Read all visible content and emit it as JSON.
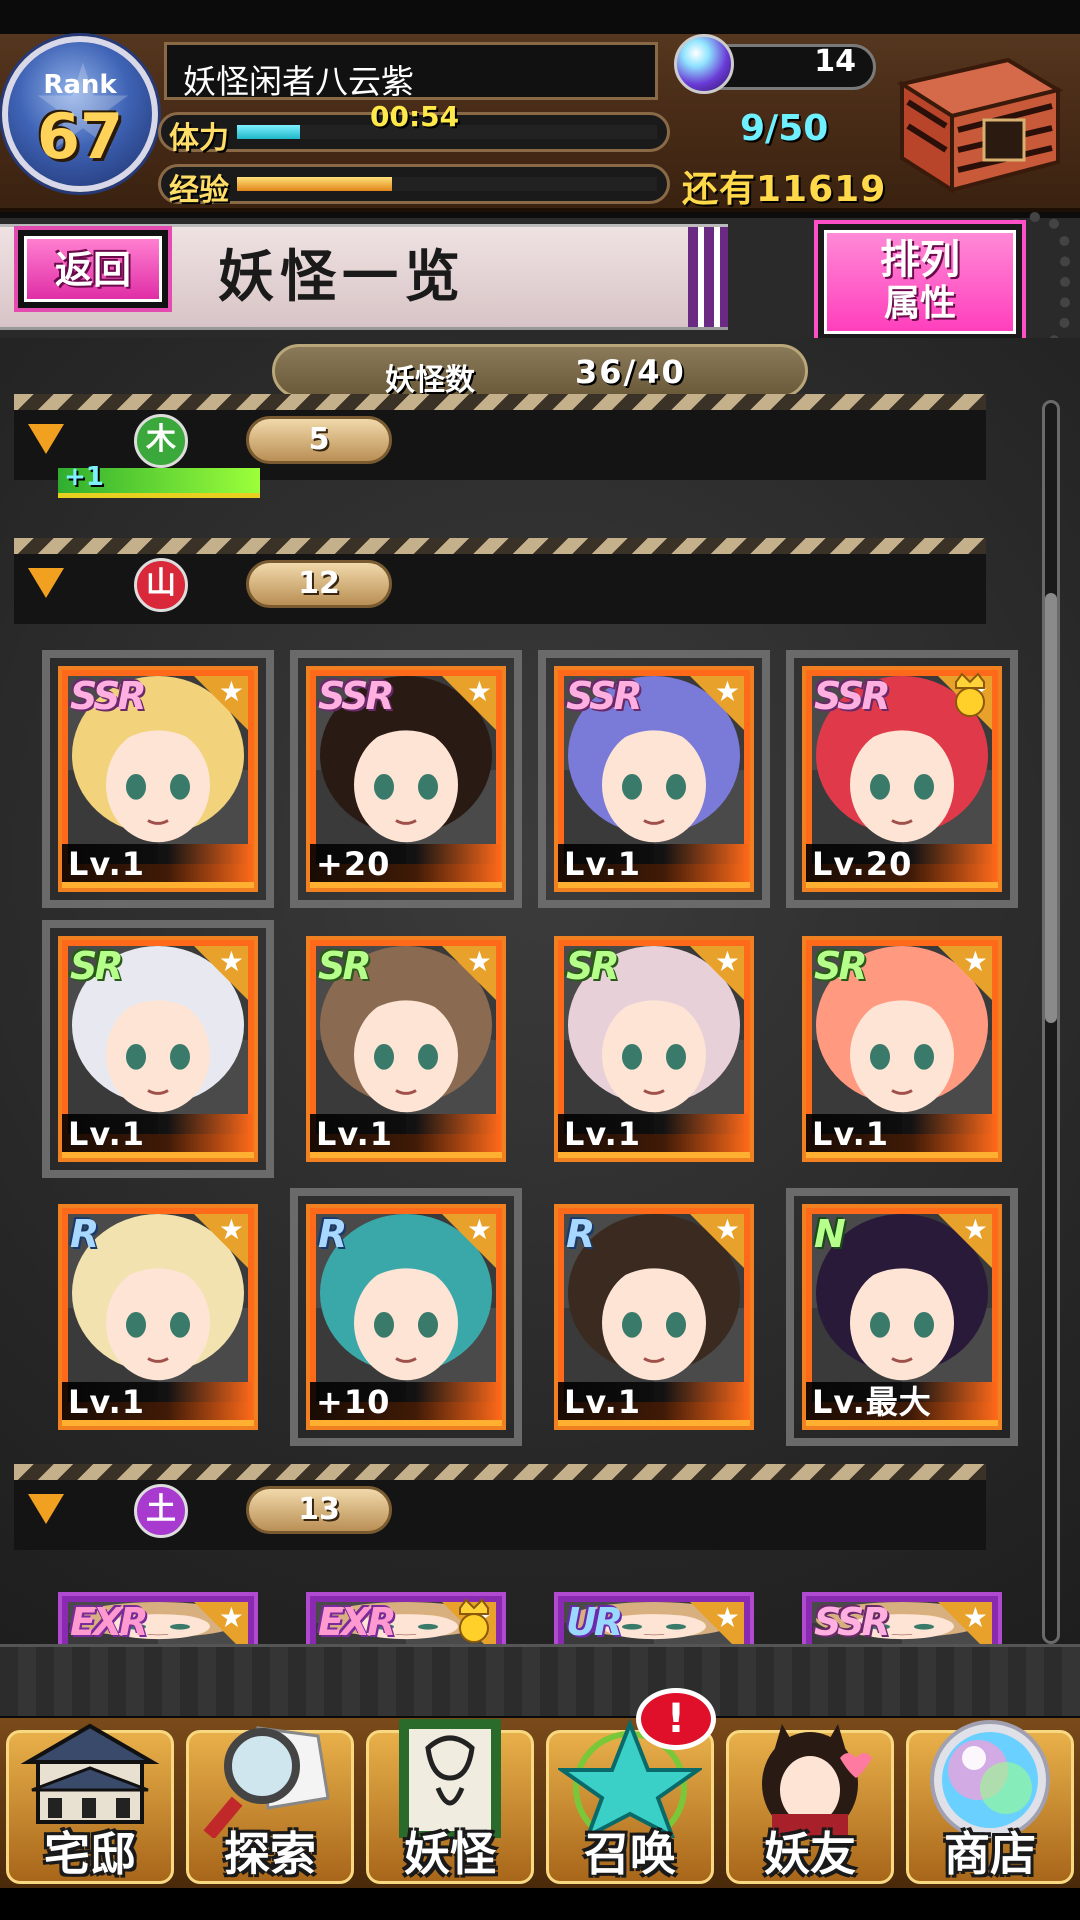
{
  "player": {
    "rank_label": "Rank",
    "rank": "67",
    "name": "妖怪闲者八云紫",
    "orbs": "14",
    "stamina_label": "体力",
    "stamina_timer": "00:54",
    "stamina_count": "9/50",
    "stamina_fraction": 0.15,
    "exp_label": "经验",
    "exp_remaining": "还有11619",
    "exp_fraction": 0.37
  },
  "header": {
    "back_label": "返回",
    "title": "妖怪一览",
    "sort_line1": "排列",
    "sort_line2": "属性"
  },
  "summary": {
    "count_label": "妖怪数",
    "count_value": "36/40"
  },
  "groups": [
    {
      "attr_glyph": "木",
      "attr_color": "#3aa83a",
      "count": "5",
      "bonus": "+1"
    },
    {
      "attr_glyph": "山",
      "attr_color": "#d8283a",
      "count": "12"
    },
    {
      "attr_glyph": "土",
      "attr_color": "#a83ad0",
      "count": "13"
    }
  ],
  "cards_group2": [
    {
      "rarity": "SSR",
      "level": "Lv.1",
      "hair": "#f2d27a",
      "framed": true,
      "crown": false
    },
    {
      "rarity": "SSR",
      "level": "+20",
      "hair": "#2a1a14",
      "framed": true,
      "crown": false
    },
    {
      "rarity": "SSR",
      "level": "Lv.1",
      "hair": "#7a7ad8",
      "framed": true,
      "crown": false
    },
    {
      "rarity": "SSR",
      "level": "Lv.20",
      "hair": "#e03a4a",
      "framed": true,
      "crown": true
    },
    {
      "rarity": "SR",
      "level": "Lv.1",
      "hair": "#e8e8f0",
      "framed": true,
      "crown": false
    },
    {
      "rarity": "SR",
      "level": "Lv.1",
      "hair": "#8a6a50",
      "framed": false,
      "crown": false
    },
    {
      "rarity": "SR",
      "level": "Lv.1",
      "hair": "#e8d0d8",
      "framed": false,
      "crown": false
    },
    {
      "rarity": "SR",
      "level": "Lv.1",
      "hair": "#ff9a80",
      "framed": false,
      "crown": false
    },
    {
      "rarity": "R",
      "level": "Lv.1",
      "hair": "#f2e2b0",
      "framed": false,
      "crown": false
    },
    {
      "rarity": "R",
      "level": "+10",
      "hair": "#3aa8a8",
      "framed": true,
      "crown": false
    },
    {
      "rarity": "R",
      "level": "Lv.1",
      "hair": "#3a2a20",
      "framed": false,
      "crown": false
    },
    {
      "rarity": "N",
      "level": "Lv.最大",
      "hair": "#2a1a3a",
      "framed": true,
      "crown": false
    }
  ],
  "cards_group3": [
    {
      "rarity": "EXR",
      "crown": false
    },
    {
      "rarity": "EXR",
      "crown": true
    },
    {
      "rarity": "UR",
      "crown": false
    },
    {
      "rarity": "SSR",
      "crown": false
    }
  ],
  "nav": [
    {
      "label": "宅邸",
      "icon": "mansion-icon"
    },
    {
      "label": "探索",
      "icon": "magnifier-map-icon"
    },
    {
      "label": "妖怪",
      "icon": "scroll-icon"
    },
    {
      "label": "召唤",
      "icon": "pentagram-icon"
    },
    {
      "label": "妖友",
      "icon": "friend-catgirl-icon"
    },
    {
      "label": "商店",
      "icon": "crystal-orb-icon"
    }
  ],
  "summon_badge": "!"
}
